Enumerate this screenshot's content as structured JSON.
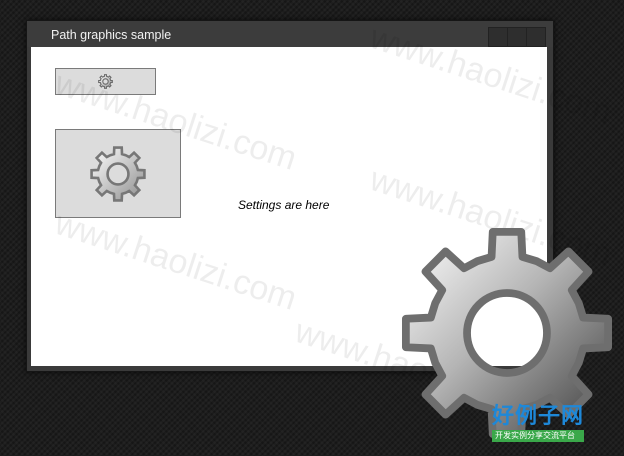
{
  "window": {
    "title": "Path graphics sample"
  },
  "content": {
    "settings_text": "Settings are here"
  },
  "icons": {
    "small_button_icon": "gear-icon",
    "large_button_icon": "gear-icon",
    "overlay_icon": "gear-icon"
  },
  "watermark": {
    "text": "www.haolizi.com"
  },
  "logo": {
    "main": "好例子网",
    "sub": "开发实例分享交流平台"
  },
  "colors": {
    "desktop_bg": "#1e1e1e",
    "titlebar": "#3c3c3c",
    "button_bg": "#dcdcdc",
    "logo_blue": "#1e88d8",
    "logo_green": "#3aa84a"
  }
}
